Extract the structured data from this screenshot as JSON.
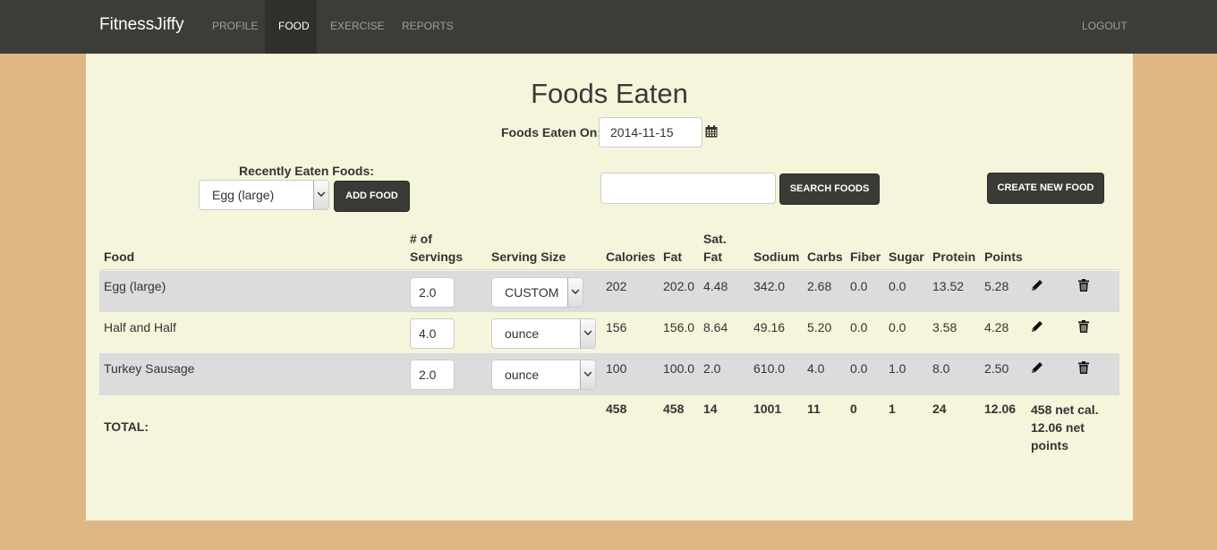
{
  "nav": {
    "brand": "FitnessJiffy",
    "items": [
      "PROFILE",
      "FOOD",
      "EXERCISE",
      "REPORTS"
    ],
    "active": "FOOD",
    "logout": "LOGOUT"
  },
  "page": {
    "title": "Foods Eaten",
    "date_label": "Foods Eaten On:",
    "date_value": "2014-11-15"
  },
  "controls": {
    "recent_label": "Recently Eaten Foods:",
    "recent_selected": "Egg (large)",
    "add_food": "ADD FOOD",
    "search_value": "",
    "search_button": "SEARCH FOODS",
    "create_button": "CREATE NEW FOOD"
  },
  "table": {
    "headers": {
      "food": "Food",
      "servings_1": "# of",
      "servings_2": "Servings",
      "serving_size": "Serving Size",
      "calories": "Calories",
      "fat": "Fat",
      "satfat_1": "Sat.",
      "satfat_2": "Fat",
      "sodium": "Sodium",
      "carbs": "Carbs",
      "fiber": "Fiber",
      "sugar": "Sugar",
      "protein": "Protein",
      "points": "Points"
    },
    "rows": [
      {
        "food": "Egg (large)",
        "servings": "2.0",
        "serving_size": "CUSTOM",
        "calories": "202",
        "fat": "202.0",
        "satfat": "4.48",
        "sodium": "342.0",
        "carbs": "2.68",
        "fiber": "0.0",
        "sugar": "0.0",
        "protein": "13.52",
        "points": "5.28"
      },
      {
        "food": "Half and Half",
        "servings": "4.0",
        "serving_size": "ounce",
        "calories": "156",
        "fat": "156.0",
        "satfat": "8.64",
        "sodium": "49.16",
        "carbs": "5.20",
        "fiber": "0.0",
        "sugar": "0.0",
        "protein": "3.58",
        "points": "4.28"
      },
      {
        "food": "Turkey Sausage",
        "servings": "2.0",
        "serving_size": "ounce",
        "calories": "100",
        "fat": "100.0",
        "satfat": "2.0",
        "sodium": "610.0",
        "carbs": "4.0",
        "fiber": "0.0",
        "sugar": "1.0",
        "protein": "8.0",
        "points": "2.50"
      }
    ],
    "total": {
      "label": "TOTAL:",
      "calories": "458",
      "fat": "458",
      "satfat": "14",
      "sodium": "1001",
      "carbs": "11",
      "fiber": "0",
      "sugar": "1",
      "protein": "24",
      "points": "12.06",
      "net_1": "458 net cal.",
      "net_2": "12.06 net",
      "net_3": "points"
    }
  },
  "icons": {
    "calendar": "calendar-icon",
    "edit": "pencil-icon",
    "delete": "trash-icon"
  }
}
